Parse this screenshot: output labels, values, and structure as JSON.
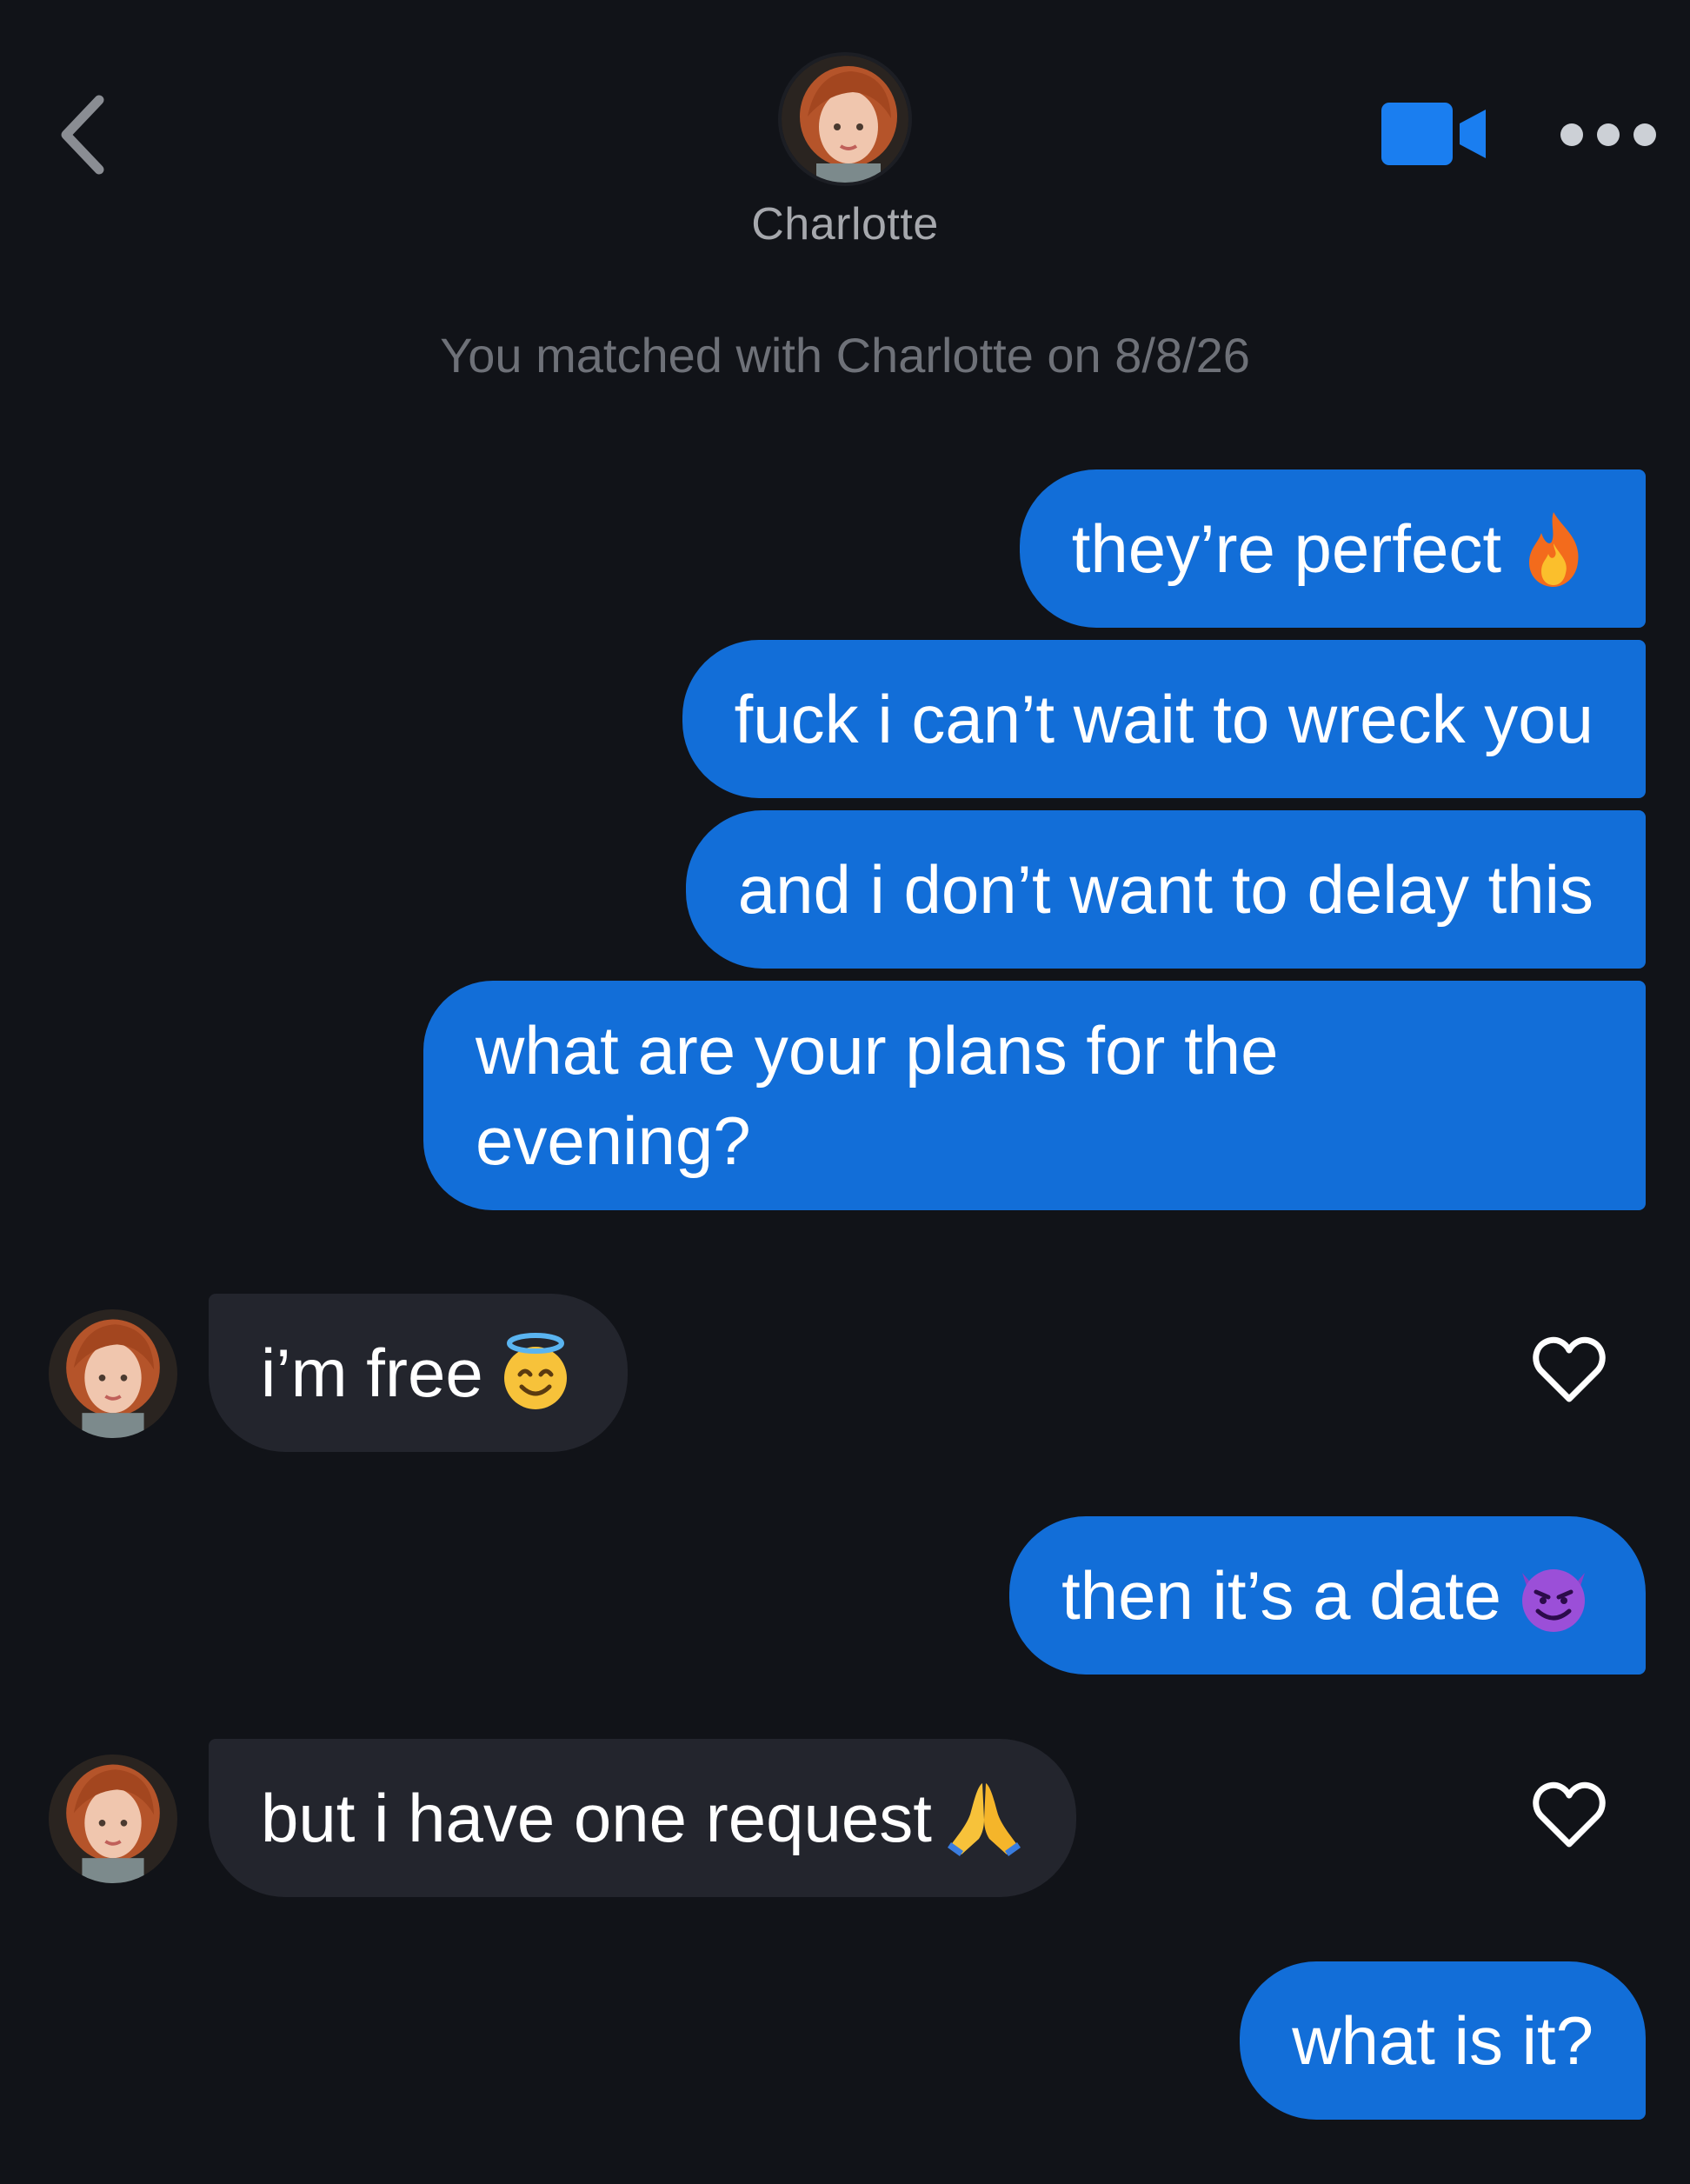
{
  "header": {
    "contact_name": "Charlotte",
    "back_icon": "chevron-left-icon",
    "video_icon": "video-camera-icon",
    "more_icon": "more-horizontal-icon",
    "accent_color": "#1a7ef0"
  },
  "match_notice": "You matched with Charlotte on 8/8/26",
  "messages": [
    {
      "from": "me",
      "text": "they’re perfect",
      "emoji": "fire-emoji"
    },
    {
      "from": "me",
      "text": "fuck i can’t wait to wreck you"
    },
    {
      "from": "me",
      "text": "and i don’t want to delay this"
    },
    {
      "from": "me",
      "text": "what are your plans for the evening?"
    },
    {
      "from": "Charlotte",
      "text": "i’m free",
      "emoji": "smiling-face-with-halo-emoji",
      "like_icon": "heart-outline-icon"
    },
    {
      "from": "me",
      "text": "then it’s a date",
      "emoji": "smiling-face-with-horns-emoji"
    },
    {
      "from": "Charlotte",
      "text": "but i have one request",
      "emoji": "folded-hands-emoji",
      "like_icon": "heart-outline-icon"
    },
    {
      "from": "me",
      "text": "what is it?"
    }
  ],
  "colors": {
    "background": "#111318",
    "sent_bubble": "#126ed8",
    "received_bubble": "#23252d",
    "notice_text": "#6e7178"
  }
}
